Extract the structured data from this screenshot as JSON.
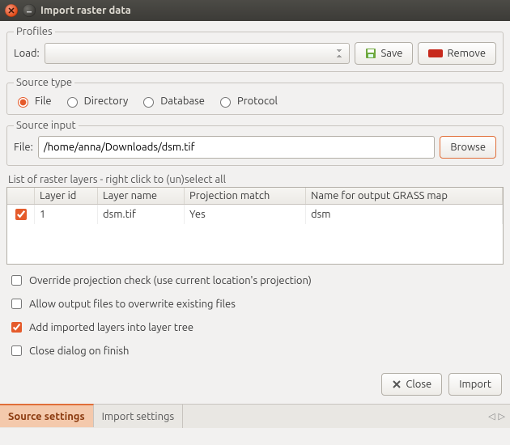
{
  "window": {
    "title": "Import raster data"
  },
  "profiles": {
    "legend": "Profiles",
    "load_label": "Load:",
    "save_label": "Save",
    "remove_label": "Remove"
  },
  "source_type": {
    "legend": "Source type",
    "options": [
      "File",
      "Directory",
      "Database",
      "Protocol"
    ],
    "selected": "File"
  },
  "source_input": {
    "legend": "Source input",
    "file_label": "File:",
    "file_value": "/home/anna/Downloads/dsm.tif",
    "browse_label": "Browse"
  },
  "layer_list": {
    "label": "List of raster layers - right click to (un)select all",
    "columns": [
      "Layer id",
      "Layer name",
      "Projection match",
      "Name for output GRASS map"
    ],
    "rows": [
      {
        "checked": true,
        "id": "1",
        "name": "dsm.tif",
        "proj": "Yes",
        "out": "dsm"
      }
    ]
  },
  "options": [
    {
      "label": "Override projection check (use current location's projection)",
      "checked": false
    },
    {
      "label": "Allow output files to overwrite existing files",
      "checked": false
    },
    {
      "label": "Add imported layers into layer tree",
      "checked": true
    },
    {
      "label": "Close dialog on finish",
      "checked": false
    }
  ],
  "buttons": {
    "close": "Close",
    "import": "Import"
  },
  "tabs": {
    "items": [
      "Source settings",
      "Import settings"
    ],
    "active": 0
  }
}
